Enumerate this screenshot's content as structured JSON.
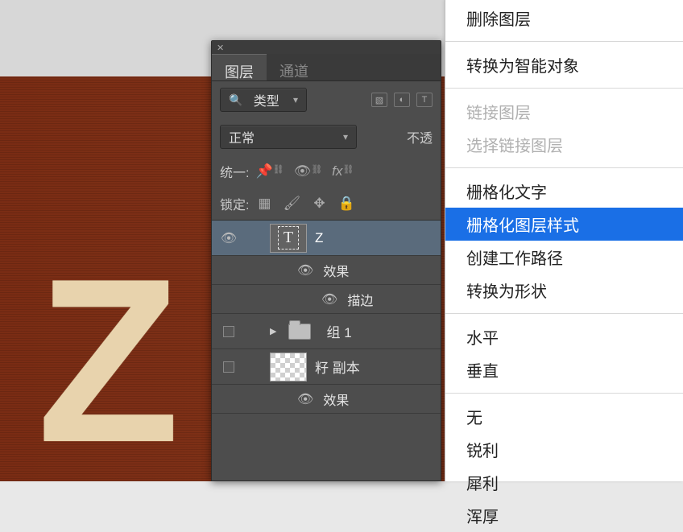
{
  "panel": {
    "tabs": {
      "layers": "图层",
      "channels": "通道"
    },
    "filter": {
      "label": "类型"
    },
    "blend_mode": "正常",
    "opacity_label_fragment": "不透",
    "unify_label": "统一:",
    "lock_label": "锁定:"
  },
  "layers": [
    {
      "kind": "text",
      "name": "Z",
      "selected": true,
      "visible": true
    },
    {
      "kind": "effects_header",
      "name": "效果",
      "visible": true
    },
    {
      "kind": "effect",
      "name": "描边",
      "visible": true
    },
    {
      "kind": "group",
      "name": "组 1",
      "visible": false
    },
    {
      "kind": "raster",
      "name": "籽 副本",
      "visible": false
    },
    {
      "kind": "effects_header",
      "name": "效果",
      "visible": true
    }
  ],
  "context_menu": {
    "sections": [
      [
        {
          "label": "删除图层",
          "disabled": false
        }
      ],
      [
        {
          "label": "转换为智能对象",
          "disabled": false
        }
      ],
      [
        {
          "label": "链接图层",
          "disabled": true
        },
        {
          "label": "选择链接图层",
          "disabled": true
        }
      ],
      [
        {
          "label": "栅格化文字",
          "disabled": false
        },
        {
          "label": "栅格化图层样式",
          "disabled": false,
          "highlight": true
        },
        {
          "label": "创建工作路径",
          "disabled": false
        },
        {
          "label": "转换为形状",
          "disabled": false
        }
      ],
      [
        {
          "label": "水平",
          "disabled": false
        },
        {
          "label": "垂直",
          "disabled": false
        }
      ],
      [
        {
          "label": "无",
          "disabled": false
        },
        {
          "label": "锐利",
          "disabled": false
        },
        {
          "label": "犀利",
          "disabled": false
        },
        {
          "label": "浑厚",
          "disabled": false
        }
      ]
    ]
  },
  "canvas": {
    "letter": "Z"
  }
}
